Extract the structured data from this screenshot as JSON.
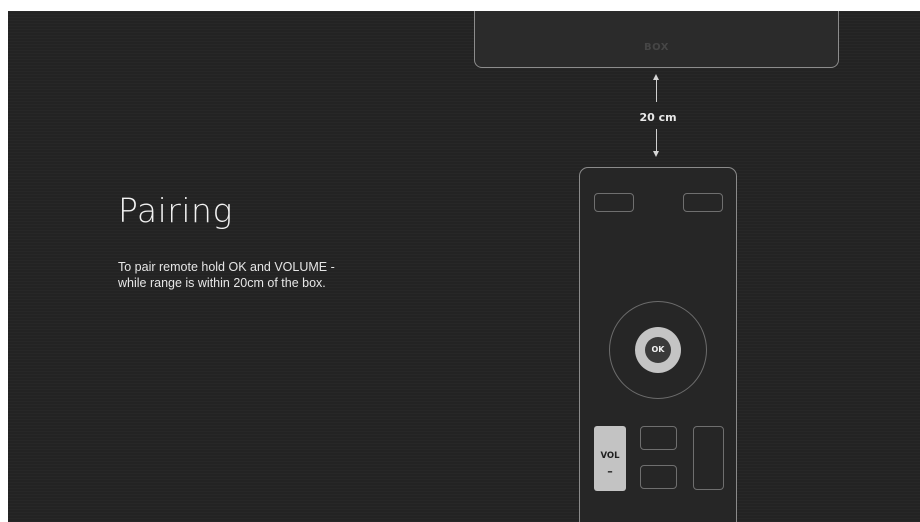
{
  "pairing": {
    "title": "Pairing",
    "instructions": [
      "To pair remote hold OK and VOLUME -",
      "while range is within 20cm of the box."
    ]
  },
  "diagram": {
    "box_label": "BOX",
    "distance_label": "20 cm",
    "remote": {
      "ok_label": "OK",
      "volume_label": "VOL",
      "volume_sign": "–"
    }
  },
  "colors": {
    "background": "#232323",
    "text": "#f2f2f2",
    "outline": "#8a8a8a",
    "highlight_button": "#c4c4c4"
  }
}
